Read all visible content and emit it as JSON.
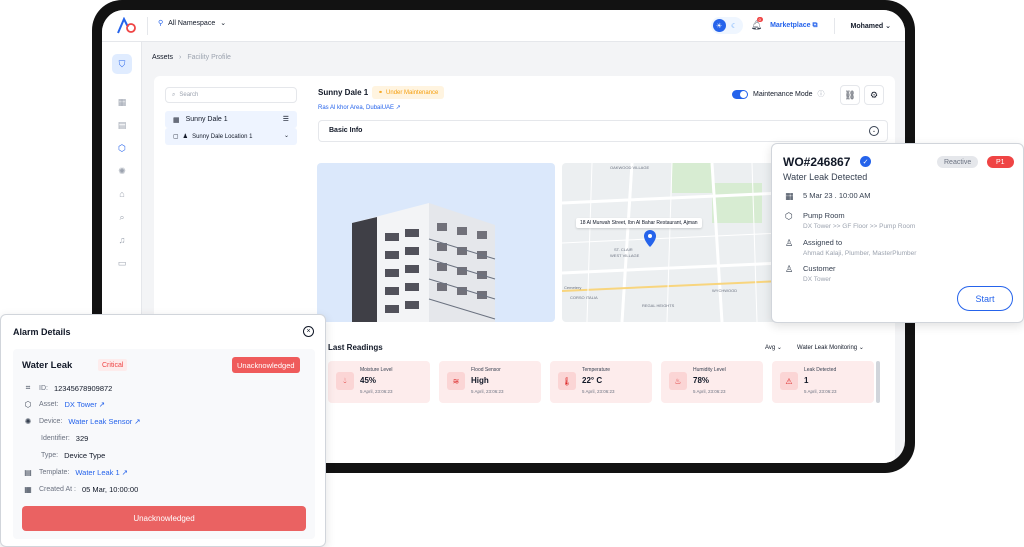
{
  "topbar": {
    "namespace": "All Namespace",
    "notification_count": "0",
    "marketplace": "Marketplace",
    "user": "Mohamed"
  },
  "breadcrumb": {
    "root": "Assets",
    "current": "Facility Profile"
  },
  "sidebar_tree": {
    "search_placeholder": "Search",
    "items": [
      {
        "label": "Sunny Dale 1"
      },
      {
        "label": "Sunny Dale Location 1"
      }
    ]
  },
  "asset": {
    "title": "Sunny Dale 1",
    "status": "Under Maintenance",
    "address": "Ras Al khor Area, DubaiUAE ↗",
    "maintenance_mode_label": "Maintenance Mode",
    "maintenance_mode_on": true,
    "basic_info": "Basic Info"
  },
  "map": {
    "label": "18 Al Murwah Street, Ibn Al Bahar Restaurant, Ajman",
    "places": [
      "OAKWOOD VILLAGE",
      "WEST VILLAGE",
      "ST. CLAIR",
      "CORSO ITALIA",
      "WYCHWOOD",
      "REGAL HEIGHTS",
      "Cemetery"
    ]
  },
  "readings": {
    "title": "Last Readings",
    "aggregation": "Avg",
    "monitor": "Water Leak Monitoring",
    "cards": [
      {
        "label": "Moisture Level",
        "value": "45%",
        "time": "5 April, 23:06:23"
      },
      {
        "label": "Flood Sensor",
        "value": "High",
        "time": "5 April, 23:06:23"
      },
      {
        "label": "Temperature",
        "value": "22° C",
        "time": "5 April, 23:06:23"
      },
      {
        "label": "Humidity Level",
        "value": "78%",
        "time": "5 April, 23:06:23"
      },
      {
        "label": "Leak Detected",
        "value": "1",
        "time": "5 April, 23:06:23"
      }
    ]
  },
  "work_order": {
    "id": "WO#246867",
    "type": "Reactive",
    "priority": "P1",
    "title": "Water Leak Detected",
    "date": "5 Mar 23 . 10:00 AM",
    "location_title": "Pump Room",
    "location_path": "DX Tower >> GF Floor >> Pump Room",
    "assigned_label": "Assigned to",
    "assigned": "Ahmad Kalaji, Plumber, MasterPlumber",
    "customer_label": "Customer",
    "customer": "DX Tower",
    "start": "Start"
  },
  "alarm": {
    "heading": "Alarm Details",
    "title": "Water Leak",
    "severity": "Critical",
    "state": "Unacknowledged",
    "id_label": "ID:",
    "id": "12345678909872",
    "asset_label": "Asset:",
    "asset": "DX Tower ↗",
    "device_label": "Device:",
    "device": "Water Leak Sensor ↗",
    "identifier_label": "Identifier:",
    "identifier": "329",
    "type_label": "Type:",
    "type": "Device Type",
    "template_label": "Template:",
    "template": "Water Leak 1 ↗",
    "created_label": "Created At :",
    "created": "05 Mar, 10:00:00",
    "button": "Unacknowledged"
  },
  "colors": {
    "accent": "#2563eb",
    "danger": "#ef4444",
    "warning": "#f59e0b",
    "reading_bg": "#fdecec"
  }
}
